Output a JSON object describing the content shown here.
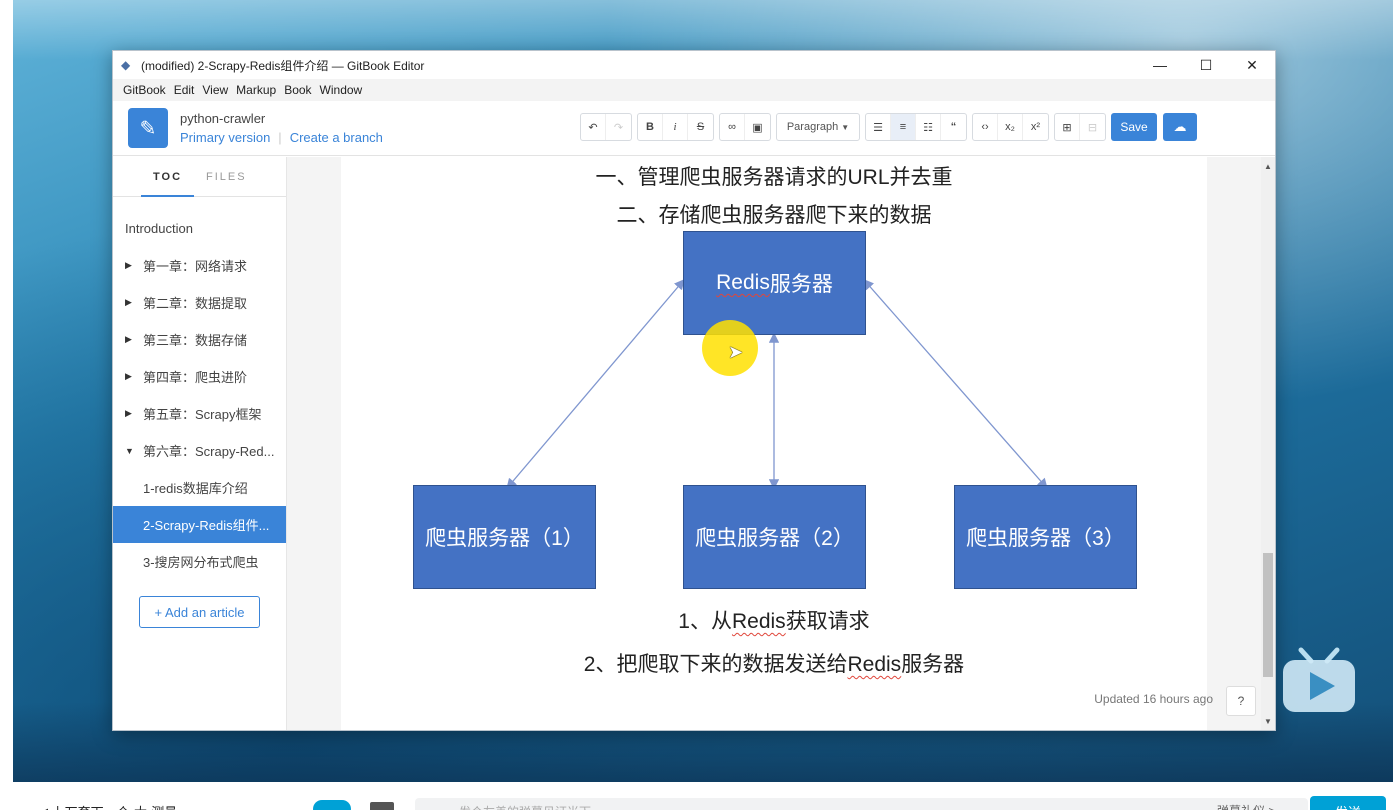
{
  "window": {
    "title": "(modified) 2-Scrapy-Redis组件介绍 — GitBook Editor",
    "controls": {
      "minimize": "—",
      "maximize": "☐",
      "close": "✕"
    }
  },
  "menubar": [
    "GitBook",
    "Edit",
    "View",
    "Markup",
    "Book",
    "Window"
  ],
  "book": {
    "title": "python-crawler",
    "version": "Primary version",
    "branch_link": "Create a branch"
  },
  "toolbar": {
    "paragraph_select": "Paragraph",
    "save_label": "Save",
    "icons": [
      "undo-icon",
      "redo-icon",
      "bold-icon",
      "italic-icon",
      "strikethrough-icon",
      "link-icon",
      "image-icon",
      "bullet-list-icon",
      "numbered-list-icon",
      "task-list-icon",
      "quote-icon",
      "code-icon",
      "subscript-icon",
      "superscript-icon",
      "table-icon",
      "html-icon",
      "cloud-sync-icon"
    ]
  },
  "sidebar": {
    "tabs": [
      "TOC",
      "FILES"
    ],
    "items": [
      {
        "label": "Introduction",
        "arrow": ""
      },
      {
        "label": "第一章：网络请求",
        "arrow": "▶"
      },
      {
        "label": "第二章：数据提取",
        "arrow": "▶"
      },
      {
        "label": "第三章：数据存储",
        "arrow": "▶"
      },
      {
        "label": "第四章：爬虫进阶",
        "arrow": "▶"
      },
      {
        "label": "第五章：Scrapy框架",
        "arrow": "▶"
      },
      {
        "label": "第六章：Scrapy-Red...",
        "arrow": "▼"
      },
      {
        "label": "1-redis数据库介绍",
        "arrow": ""
      },
      {
        "label": "2-Scrapy-Redis组件...",
        "arrow": ""
      },
      {
        "label": "3-搜房网分布式爬虫",
        "arrow": ""
      }
    ],
    "add_article": "+ Add an article"
  },
  "slide": {
    "line1": "一、管理爬虫服务器请求的URL并去重",
    "line2": "二、存储爬虫服务器爬下来的数据",
    "redis_box": {
      "prefix": "Redis",
      "suffix": "服务器"
    },
    "crawlers": [
      "爬虫服务器（1）",
      "爬虫服务器（2）",
      "爬虫服务器（3）"
    ],
    "step1": {
      "before": "1、从",
      "redis": "Redis",
      "after": "获取请求"
    },
    "step2": {
      "before": "2、把爬取下来的数据发送给",
      "redis": "Redis",
      "after": "服务器"
    },
    "box_color": "#4472c4",
    "arrow_color": "#7f96cf"
  },
  "status": {
    "updated": "Updated 16 hours ago",
    "help": "?"
  },
  "bottom_bar": {
    "prev": "◀ 上万套下一个·大·测量",
    "input_placeholder": "发个友善的弹幕见证当下",
    "etiquette": "弹幕礼仪 >",
    "send": "发送"
  },
  "colors": {
    "accent": "#3a84d8",
    "bilibili": "#00a1d6"
  }
}
